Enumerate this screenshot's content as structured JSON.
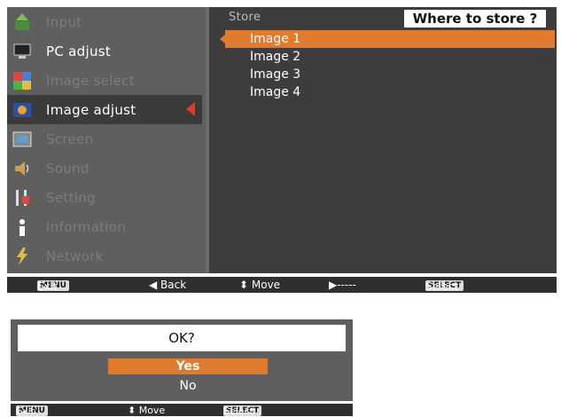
{
  "sidebar": {
    "items": [
      {
        "label": "Input",
        "icon": "input-icon",
        "enabled": false
      },
      {
        "label": "PC adjust",
        "icon": "pc-adjust-icon",
        "enabled": true
      },
      {
        "label": "Image select",
        "icon": "image-select-icon",
        "enabled": false
      },
      {
        "label": "Image adjust",
        "icon": "image-adjust-icon",
        "enabled": true,
        "selected": true
      },
      {
        "label": "Screen",
        "icon": "screen-icon",
        "enabled": false
      },
      {
        "label": "Sound",
        "icon": "sound-icon",
        "enabled": false
      },
      {
        "label": "Setting",
        "icon": "setting-icon",
        "enabled": false
      },
      {
        "label": "Information",
        "icon": "information-icon",
        "enabled": false
      },
      {
        "label": "Network",
        "icon": "network-icon",
        "enabled": false
      }
    ]
  },
  "panel": {
    "title": "Store",
    "where_label": "Where to store ?",
    "items": [
      {
        "label": "Image 1",
        "selected": true
      },
      {
        "label": "Image 2"
      },
      {
        "label": "Image 3"
      },
      {
        "label": "Image 4"
      }
    ]
  },
  "statusbar": {
    "exit_key": "MENU",
    "exit": "Exit",
    "back": "◀ Back",
    "move": "⬍ Move",
    "next": "▶-----",
    "select_key": "SELECT",
    "select": "Select"
  },
  "dialog": {
    "title": "OK?",
    "yes": "Yes",
    "no": "No"
  },
  "dialog_statusbar": {
    "exit_key": "MENU",
    "exit": "Exit",
    "move": "⬍ Move",
    "select_key": "SELECT",
    "select": "Select"
  },
  "colors": {
    "accent": "#e07a2c",
    "selector_arrow": "#e03a2a"
  }
}
